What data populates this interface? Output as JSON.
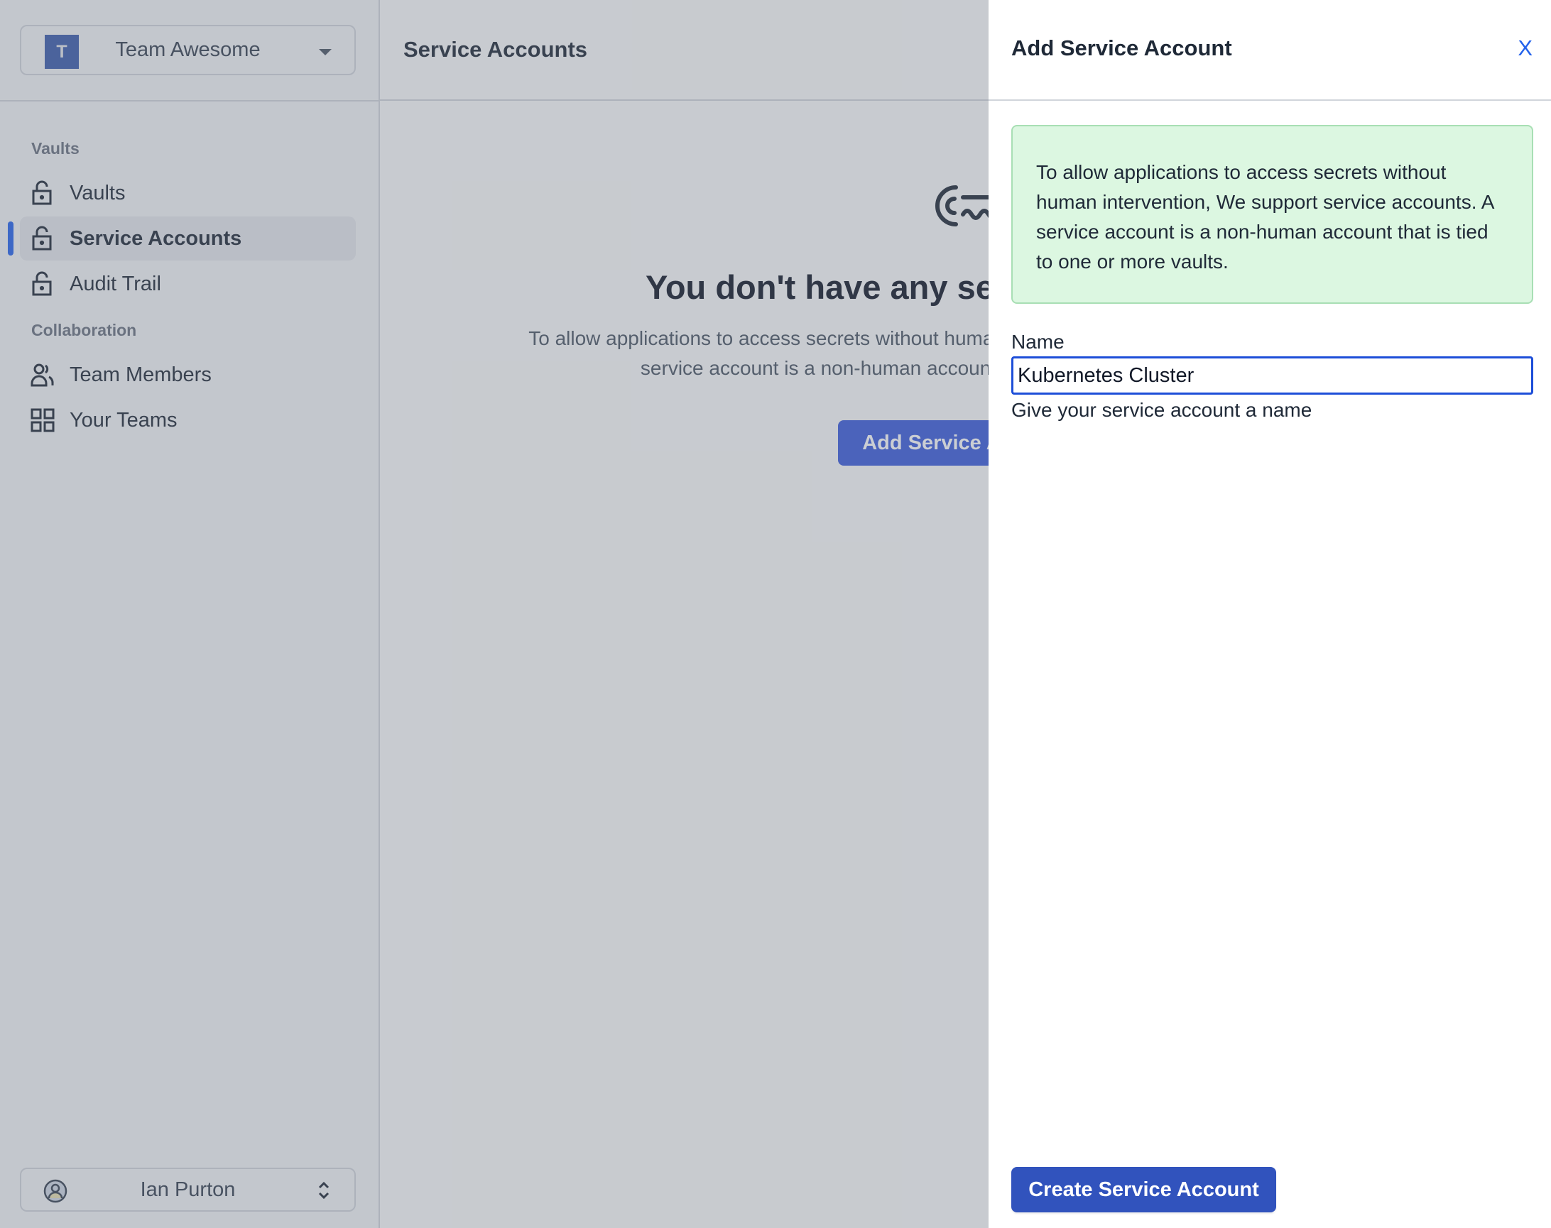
{
  "sidebar": {
    "team": {
      "initial": "T",
      "name": "Team Awesome",
      "avatar_color": "#3b5bab"
    },
    "sections": [
      {
        "label": "Vaults"
      },
      {
        "label": "Collaboration"
      }
    ],
    "items": [
      {
        "label": "Vaults",
        "icon": "lock-open-icon",
        "active": false
      },
      {
        "label": "Service Accounts",
        "icon": "lock-open-icon",
        "active": true
      },
      {
        "label": "Audit Trail",
        "icon": "lock-open-icon",
        "active": false
      },
      {
        "label": "Team Members",
        "icon": "users-icon",
        "active": false
      },
      {
        "label": "Your Teams",
        "icon": "grid-icon",
        "active": false
      }
    ],
    "user": {
      "name": "Ian Purton",
      "icon": "user-circle-icon"
    },
    "accent_color": "#2563eb"
  },
  "main": {
    "title": "Service Accounts",
    "empty_state": {
      "icon": "key-icon",
      "heading": "You don't have any service accounts yet",
      "description": "To allow applications to access secrets without human intervention, We support service accounts. A service account is a non-human account that is tied to one or more vaults.",
      "button_label": "Add Service Account"
    }
  },
  "drawer": {
    "title": "Add Service Account",
    "close_label": "X",
    "info": "To allow applications to access secrets without human intervention, We support service accounts. A service account is a non-human account that is tied to one or more vaults.",
    "info_bg": "#dcf7e1",
    "form": {
      "name_label": "Name",
      "name_value": "Kubernetes Cluster",
      "name_help": "Give your service account a name"
    },
    "submit_label": "Create Service Account",
    "submit_color": "#3153bd"
  }
}
